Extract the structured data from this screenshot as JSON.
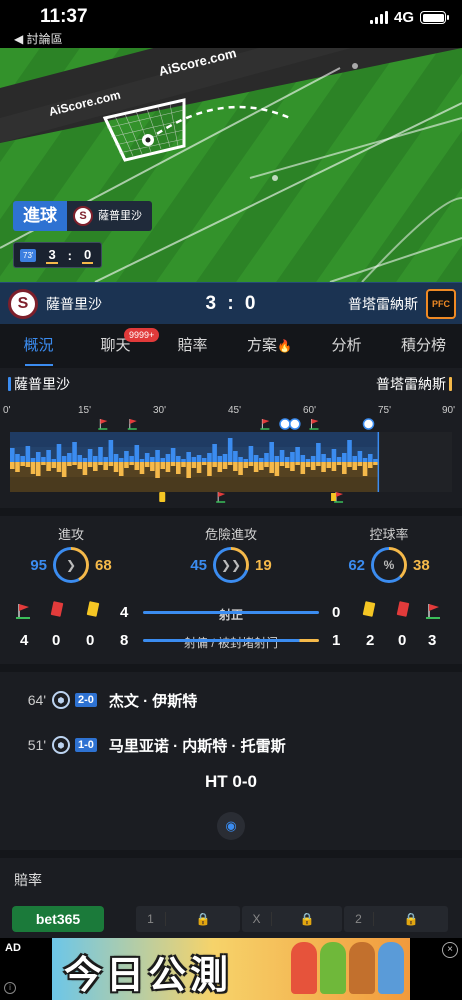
{
  "status_bar": {
    "time": "11:37",
    "back_label": "◀ 討論區",
    "network": "4G"
  },
  "pitch": {
    "watermark": "AiScore.com",
    "event_label": "進球",
    "event_team": "薩普里沙",
    "minute": "73'",
    "home_score": "3",
    "away_score": "0",
    "separator": ":"
  },
  "scorebar": {
    "home_name": "薩普里沙",
    "home_logo_letter": "S",
    "score": "3 : 0",
    "away_name": "普塔雷納斯",
    "away_logo_text": "PFC"
  },
  "tabs": [
    {
      "label": "概況",
      "active": true
    },
    {
      "label": "聊天",
      "badge": "9999+"
    },
    {
      "label": "賠率"
    },
    {
      "label": "方案"
    },
    {
      "label": "分析"
    },
    {
      "label": "積分榜"
    }
  ],
  "timeline": {
    "home_name": "薩普里沙",
    "away_name": "普塔雷納斯",
    "ticks": [
      "0'",
      "15'",
      "30'",
      "45'",
      "60'",
      "75'",
      "90'"
    ],
    "current_minute": 75,
    "pressure": [
      {
        "h": 14,
        "a": 7
      },
      {
        "h": 8,
        "a": 10
      },
      {
        "h": 6,
        "a": 4
      },
      {
        "h": 16,
        "a": 5
      },
      {
        "h": 4,
        "a": 12
      },
      {
        "h": 10,
        "a": 14
      },
      {
        "h": 5,
        "a": 3
      },
      {
        "h": 12,
        "a": 9
      },
      {
        "h": 3,
        "a": 6
      },
      {
        "h": 18,
        "a": 10
      },
      {
        "h": 6,
        "a": 15
      },
      {
        "h": 9,
        "a": 4
      },
      {
        "h": 20,
        "a": 3
      },
      {
        "h": 7,
        "a": 7
      },
      {
        "h": 4,
        "a": 13
      },
      {
        "h": 13,
        "a": 5
      },
      {
        "h": 6,
        "a": 9
      },
      {
        "h": 15,
        "a": 3
      },
      {
        "h": 5,
        "a": 8
      },
      {
        "h": 22,
        "a": 4
      },
      {
        "h": 8,
        "a": 10
      },
      {
        "h": 4,
        "a": 14
      },
      {
        "h": 11,
        "a": 6
      },
      {
        "h": 6,
        "a": 3
      },
      {
        "h": 17,
        "a": 8
      },
      {
        "h": 3,
        "a": 12
      },
      {
        "h": 9,
        "a": 5
      },
      {
        "h": 5,
        "a": 9
      },
      {
        "h": 12,
        "a": 16
      },
      {
        "h": 4,
        "a": 7
      },
      {
        "h": 8,
        "a": 10
      },
      {
        "h": 14,
        "a": 4
      },
      {
        "h": 6,
        "a": 12
      },
      {
        "h": 3,
        "a": 5
      },
      {
        "h": 10,
        "a": 16
      },
      {
        "h": 5,
        "a": 6
      },
      {
        "h": 7,
        "a": 11
      },
      {
        "h": 4,
        "a": 3
      },
      {
        "h": 9,
        "a": 14
      },
      {
        "h": 18,
        "a": 5
      },
      {
        "h": 6,
        "a": 10
      },
      {
        "h": 8,
        "a": 7
      },
      {
        "h": 24,
        "a": 3
      },
      {
        "h": 11,
        "a": 9
      },
      {
        "h": 5,
        "a": 13
      },
      {
        "h": 3,
        "a": 6
      },
      {
        "h": 16,
        "a": 4
      },
      {
        "h": 7,
        "a": 10
      },
      {
        "h": 4,
        "a": 8
      },
      {
        "h": 9,
        "a": 5
      },
      {
        "h": 20,
        "a": 11
      },
      {
        "h": 6,
        "a": 14
      },
      {
        "h": 12,
        "a": 4
      },
      {
        "h": 5,
        "a": 6
      },
      {
        "h": 10,
        "a": 9
      },
      {
        "h": 15,
        "a": 3
      },
      {
        "h": 7,
        "a": 12
      },
      {
        "h": 3,
        "a": 5
      },
      {
        "h": 6,
        "a": 8
      },
      {
        "h": 19,
        "a": 4
      },
      {
        "h": 8,
        "a": 10
      },
      {
        "h": 4,
        "a": 6
      },
      {
        "h": 13,
        "a": 9
      },
      {
        "h": 5,
        "a": 3
      },
      {
        "h": 9,
        "a": 12
      },
      {
        "h": 22,
        "a": 5
      },
      {
        "h": 6,
        "a": 8
      },
      {
        "h": 11,
        "a": 4
      },
      {
        "h": 4,
        "a": 14
      },
      {
        "h": 8,
        "a": 6
      },
      {
        "h": 3,
        "a": 3
      }
    ],
    "home_events": [
      {
        "min": 19,
        "type": "corner"
      },
      {
        "min": 25,
        "type": "corner"
      },
      {
        "min": 52,
        "type": "corner"
      },
      {
        "min": 56,
        "type": "goal"
      },
      {
        "min": 58,
        "type": "goal"
      },
      {
        "min": 62,
        "type": "corner"
      },
      {
        "min": 73,
        "type": "goal"
      }
    ],
    "away_events": [
      {
        "min": 31,
        "type": "yellow"
      },
      {
        "min": 43,
        "type": "corner"
      },
      {
        "min": 67,
        "type": "card-corner"
      }
    ]
  },
  "stats": {
    "attacks": {
      "title": "進攻",
      "home": "95",
      "away": "68",
      "home_share": 0.58
    },
    "dangerous": {
      "title": "危險進攻",
      "home": "45",
      "away": "19",
      "home_share": 0.7
    },
    "possession": {
      "title": "控球率",
      "home": "62",
      "away": "38",
      "home_share": 0.62
    },
    "on_target": {
      "label": "射正",
      "home": "4",
      "away": "0",
      "home_share": 1.0
    },
    "off_target": {
      "label": "射偏 / 被封堵射门",
      "home": "8",
      "away": "1",
      "home_share": 0.89
    },
    "home_counts": {
      "corners": "4",
      "red": "0",
      "yellow": "0"
    },
    "away_counts": {
      "yellow": "2",
      "red": "0",
      "corners": "3"
    },
    "colors": {
      "home": "#3b8cf0",
      "away": "#f5b94a",
      "red": "#e23b3b",
      "yellow": "#f5c624"
    }
  },
  "events": [
    {
      "minute": "64'",
      "score": "2-0",
      "player": "杰文 · 伊斯特"
    },
    {
      "minute": "51'",
      "score": "1-0",
      "player": "马里亚诺 · 内斯特 · 托雷斯"
    }
  ],
  "halftime": "HT 0-0",
  "odds": {
    "title": "賠率",
    "bookmaker": "bet365",
    "cells": [
      "1",
      "X",
      "2"
    ]
  },
  "ad": {
    "tag": "AD",
    "headline": "今日公測",
    "info": "i",
    "close": "×"
  }
}
